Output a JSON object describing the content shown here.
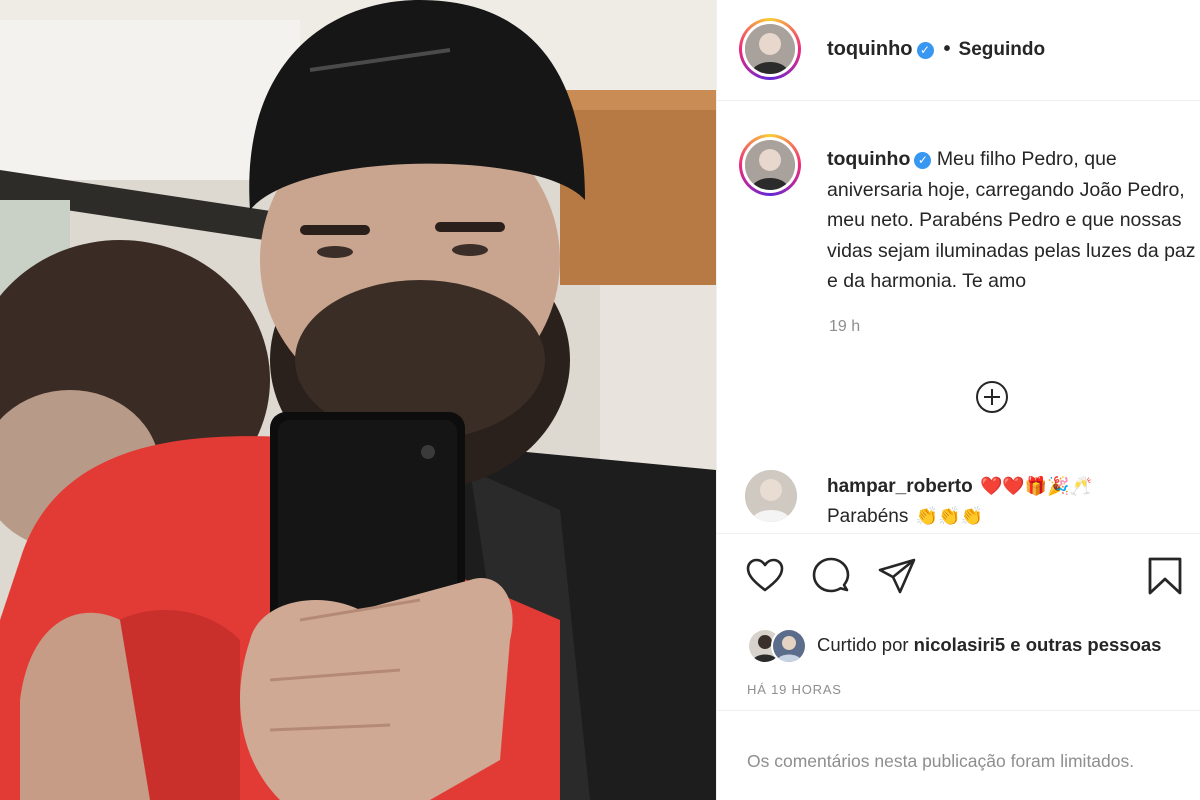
{
  "post": {
    "author": {
      "username": "toquinho",
      "verified": true,
      "follow_status": "Seguindo",
      "separator": "•"
    },
    "caption": {
      "username": "toquinho",
      "text": "Meu filho Pedro, que\naniversaria hoje, carregando João Pedro,\nmeu neto. Parabéns Pedro e que nossas\nvidas sejam iluminadas pelas luzes da paz\ne da harmonia. Te amo",
      "time": "19 h"
    },
    "load_more_icon": "plus-circle-icon",
    "comment": {
      "username": "hampar_roberto",
      "emojis": "❤️❤️🎁🎉🥂",
      "text": "Parabéns",
      "text_emojis": "👏👏👏"
    },
    "actions": {
      "like_icon": "heart-icon",
      "comment_icon": "comment-icon",
      "share_icon": "send-icon",
      "save_icon": "bookmark-icon"
    },
    "likes": {
      "prefix": "Curtido por ",
      "user": "nicolasiri5",
      "suffix": " e outras pessoas"
    },
    "posted_ago": "HÁ 19 HORAS",
    "comments_notice": "Os comentários nesta publicação foram limitados."
  },
  "colors": {
    "verified": "#3897f0",
    "secondary_text": "#8e8e8e",
    "heart_red": "#ed4956"
  }
}
